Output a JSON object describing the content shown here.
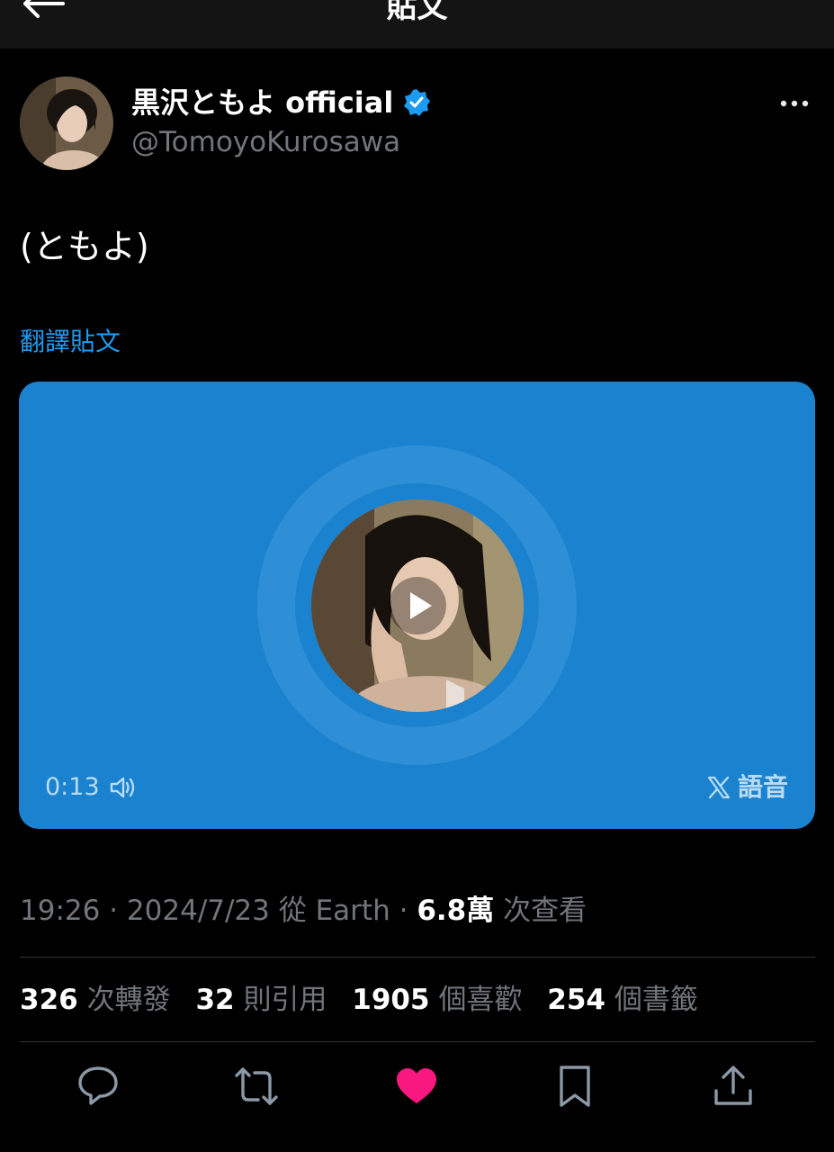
{
  "topbar": {
    "title": "貼文",
    "back_icon": "arrow-left-icon"
  },
  "author": {
    "display_name": "黒沢ともよ official",
    "handle": "@TomoyoKurosawa",
    "verified_icon": "verified-badge-icon",
    "verified_color": "#1d9bf0"
  },
  "tweet": {
    "text": "(ともよ)",
    "translate_label": "翻譯貼文"
  },
  "media": {
    "background_color": "#1b82cf",
    "duration": "0:13",
    "label": "語音",
    "play_icon": "play-icon",
    "speaker_icon": "speaker-icon",
    "x_icon": "x-logo-icon"
  },
  "meta": {
    "time": "19:26",
    "date": "2024/7/23",
    "source": "從 Earth",
    "views_count": "6.8萬",
    "views_label": "次查看",
    "sep": "·"
  },
  "stats": {
    "retweets_count": "326",
    "retweets_label": "次轉發",
    "quotes_count": "32",
    "quotes_label": "則引用",
    "likes_count": "1905",
    "likes_label": "個喜歡",
    "bookmarks_count": "254",
    "bookmarks_label": "個書籤"
  },
  "actions": {
    "like_color": "#f91880",
    "icons": [
      "reply-icon",
      "retweet-icon",
      "like-icon",
      "bookmark-icon",
      "share-icon"
    ]
  }
}
